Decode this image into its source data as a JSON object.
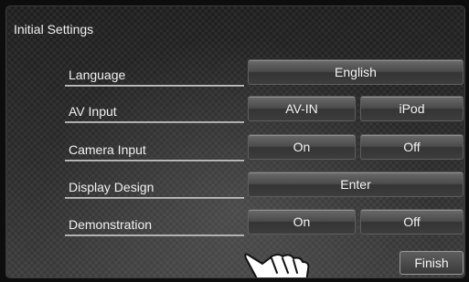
{
  "screen": {
    "title": "Initial Settings"
  },
  "settings": [
    {
      "label": "Language",
      "options": [
        "English"
      ]
    },
    {
      "label": "AV Input",
      "options": [
        "AV-IN",
        "iPod"
      ]
    },
    {
      "label": "Camera Input",
      "options": [
        "On",
        "Off"
      ]
    },
    {
      "label": "Display Design",
      "options": [
        "Enter"
      ]
    },
    {
      "label": "Demonstration",
      "options": [
        "On",
        "Off"
      ]
    }
  ],
  "footer": {
    "finish_label": "Finish"
  }
}
